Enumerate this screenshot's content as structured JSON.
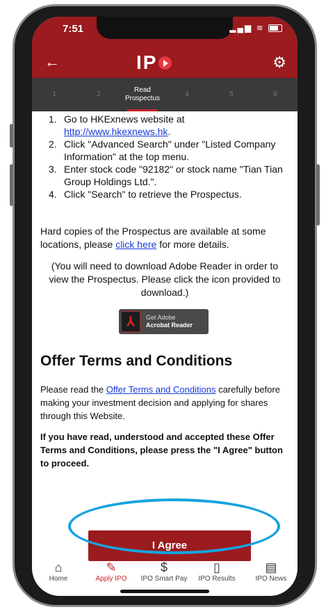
{
  "status": {
    "time": "7:51"
  },
  "header": {
    "logo": "IP"
  },
  "steps": [
    {
      "label": "1"
    },
    {
      "label": "2"
    },
    {
      "label": "Read Prospectus"
    },
    {
      "label": "4"
    },
    {
      "label": "5"
    },
    {
      "label": "6"
    }
  ],
  "instructions": {
    "item1": "Go to HKExnews website at",
    "item1_link": "http://www.hkexnews.hk",
    "item2": "Click \"Advanced Search\" under \"Listed Company Information\" at the top menu.",
    "item3": "Enter stock code \"92182\" or stock name \"Tian Tian Group Holdings Ltd.\".",
    "item4": "Click \"Search\" to retrieve the Prospectus."
  },
  "hard_copies": {
    "before": "Hard copies of the Prospectus are available at some locations, please ",
    "link": "click here",
    "after": " for more details."
  },
  "adobe_note": "(You will need to download Adobe Reader in order to view the Prospectus. Please click the icon provided to download.)",
  "adobe_badge": {
    "line1": "Get Adobe",
    "line2": "Acrobat Reader"
  },
  "offer": {
    "heading": "Offer Terms and Conditions",
    "before": "Please read the ",
    "link": "Offer Terms and Conditions",
    "after": " carefully before making your investment decision and applying for shares through this Website.",
    "bold_text": "If you have read, understood and accepted these Offer Terms and Conditions, please press the \"I Agree\" button to proceed."
  },
  "agree_button": "I Agree",
  "tabs": [
    {
      "label": "Home",
      "icon": "home-icon"
    },
    {
      "label": "Apply IPO",
      "icon": "pencil-icon"
    },
    {
      "label": "IPO Smart Pay",
      "icon": "dollar-icon"
    },
    {
      "label": "IPO Results",
      "icon": "document-icon"
    },
    {
      "label": "IPO News",
      "icon": "newspaper-icon"
    }
  ],
  "colors": {
    "brand": "#9b1b1e",
    "highlight_ring": "#16a3e0",
    "link": "#1a3bd6"
  }
}
